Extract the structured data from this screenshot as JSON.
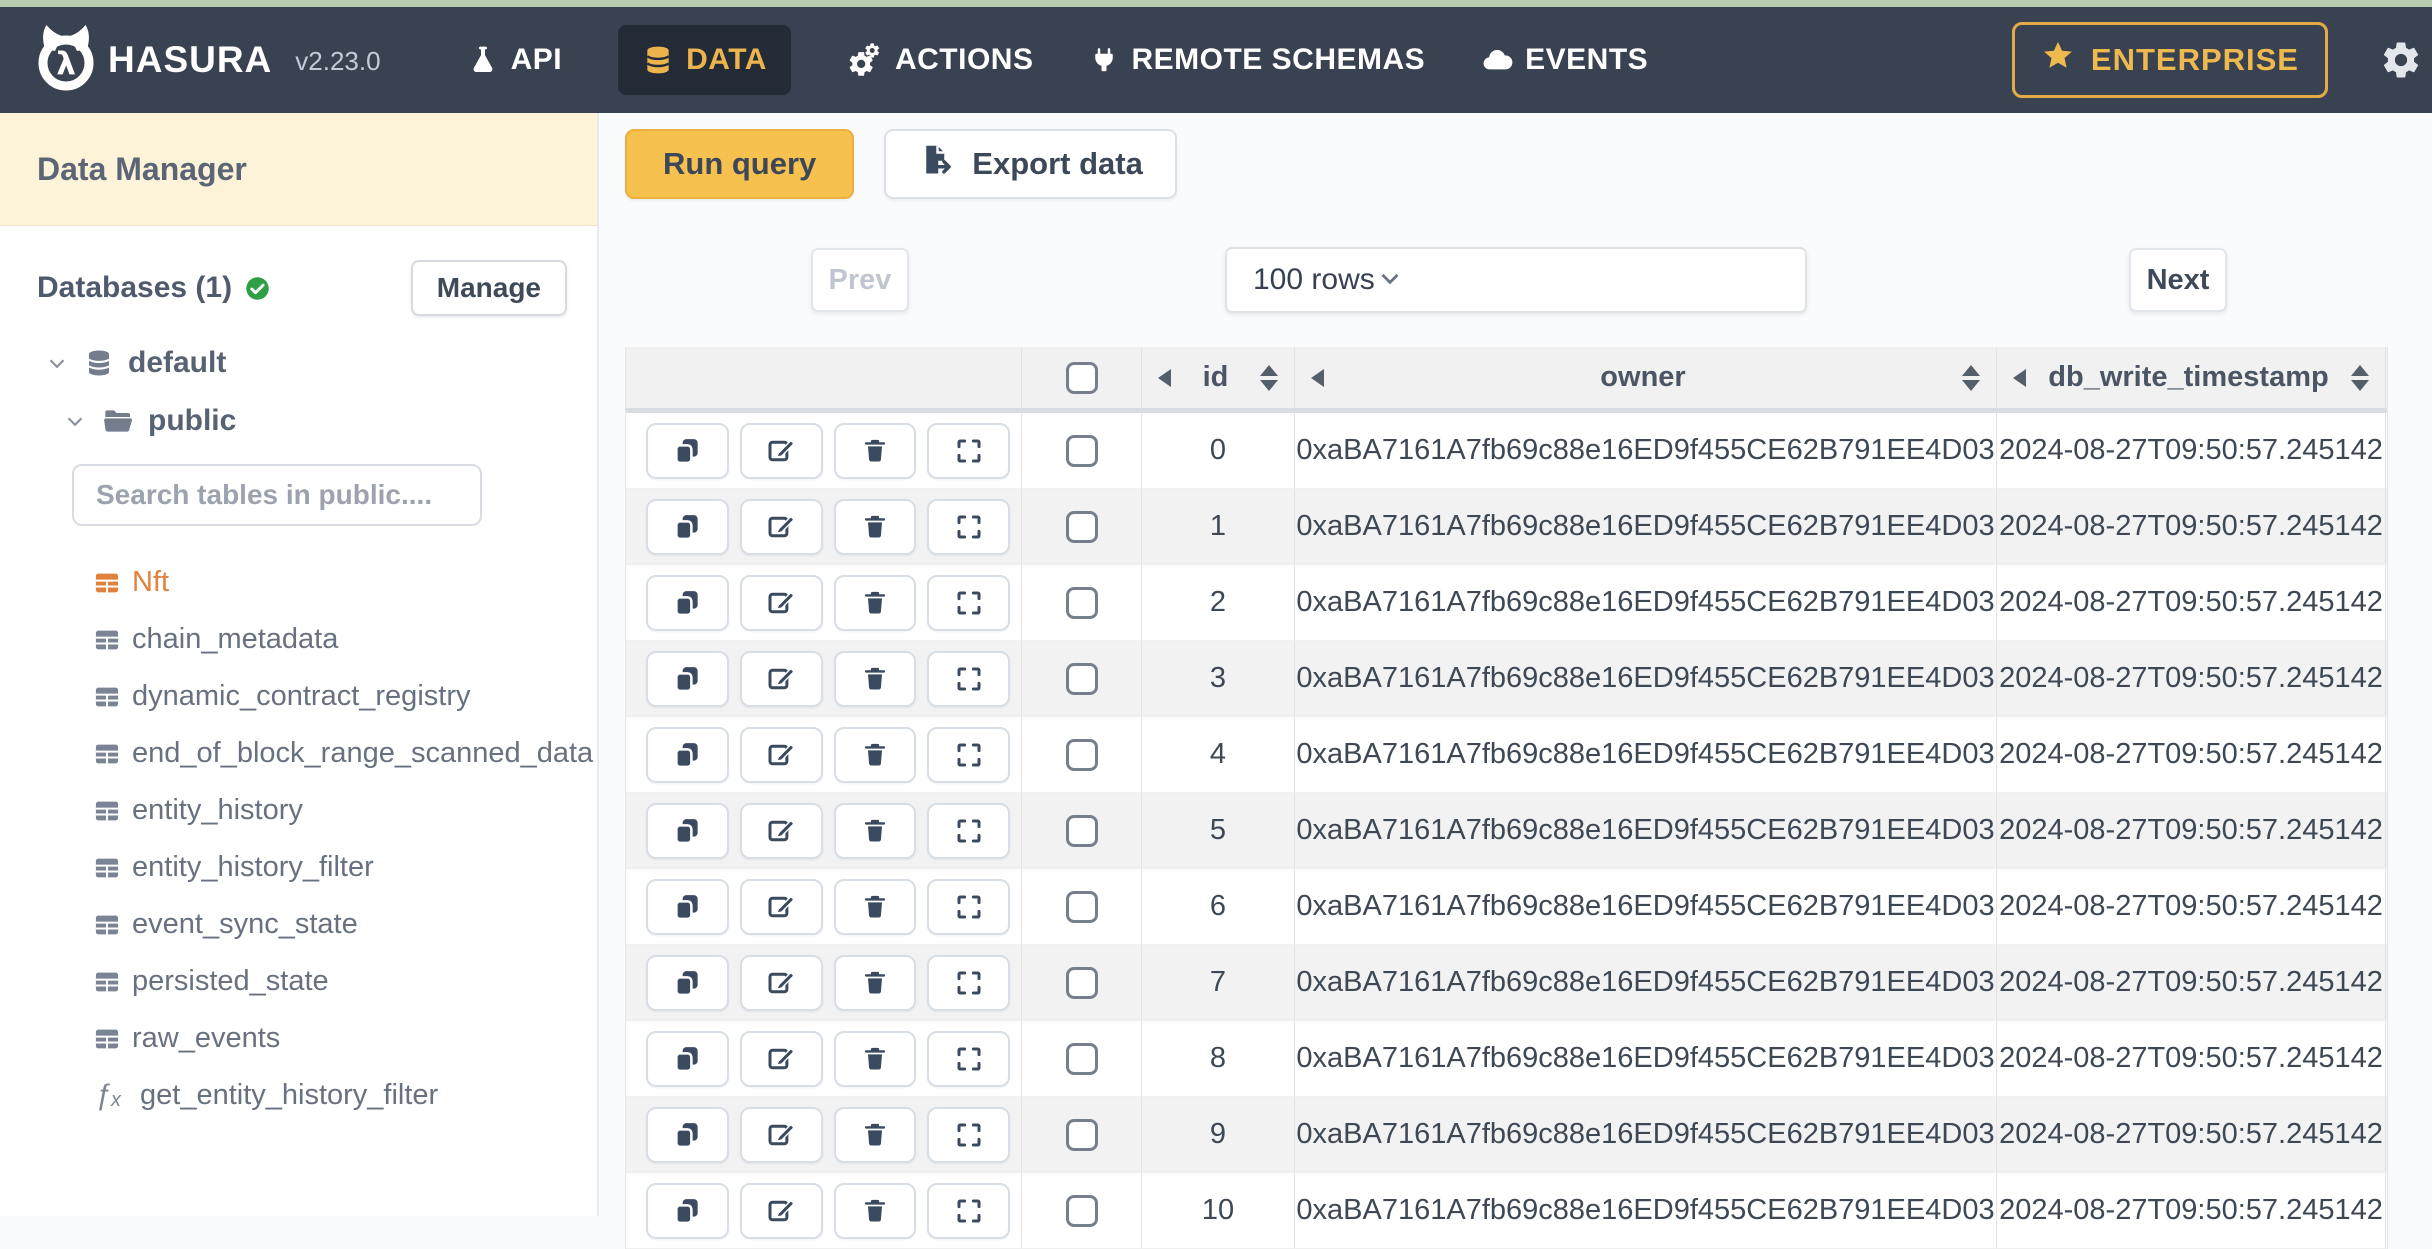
{
  "nav": {
    "brand": "HASURA",
    "version": "v2.23.0",
    "items": [
      {
        "label": "API",
        "icon": "flask-icon",
        "active": false
      },
      {
        "label": "DATA",
        "icon": "database-icon",
        "active": true
      },
      {
        "label": "ACTIONS",
        "icon": "gears-icon",
        "active": false
      },
      {
        "label": "REMOTE SCHEMAS",
        "icon": "plug-icon",
        "active": false
      },
      {
        "label": "EVENTS",
        "icon": "cloud-icon",
        "active": false
      }
    ],
    "enterprise": "ENTERPRISE"
  },
  "sidebar": {
    "title": "Data Manager",
    "databases_label": "Databases (1)",
    "manage_button": "Manage",
    "database_name": "default",
    "schema_name": "public",
    "search_placeholder": "Search tables in public....",
    "tables": [
      {
        "name": "Nft",
        "active": true
      },
      {
        "name": "chain_metadata",
        "active": false
      },
      {
        "name": "dynamic_contract_registry",
        "active": false
      },
      {
        "name": "end_of_block_range_scanned_data",
        "active": false
      },
      {
        "name": "entity_history",
        "active": false
      },
      {
        "name": "entity_history_filter",
        "active": false
      },
      {
        "name": "event_sync_state",
        "active": false
      },
      {
        "name": "persisted_state",
        "active": false
      },
      {
        "name": "raw_events",
        "active": false
      }
    ],
    "functions": [
      {
        "name": "get_entity_history_filter"
      }
    ]
  },
  "toolbar": {
    "run_query": "Run query",
    "export_data": "Export data"
  },
  "pagination": {
    "prev": "Prev",
    "page_size": "100 rows",
    "next": "Next"
  },
  "table": {
    "columns": [
      {
        "key": "id",
        "label": "id"
      },
      {
        "key": "owner",
        "label": "owner"
      },
      {
        "key": "ts",
        "label": "db_write_timestamp"
      }
    ],
    "row_actions": [
      "clone",
      "edit",
      "delete",
      "expand"
    ],
    "rows": [
      {
        "id": "0",
        "owner": "0xaBA7161A7fb69c88e16ED9f455CE62B791EE4D03",
        "ts": "2024-08-27T09:50:57.245142"
      },
      {
        "id": "1",
        "owner": "0xaBA7161A7fb69c88e16ED9f455CE62B791EE4D03",
        "ts": "2024-08-27T09:50:57.245142"
      },
      {
        "id": "2",
        "owner": "0xaBA7161A7fb69c88e16ED9f455CE62B791EE4D03",
        "ts": "2024-08-27T09:50:57.245142"
      },
      {
        "id": "3",
        "owner": "0xaBA7161A7fb69c88e16ED9f455CE62B791EE4D03",
        "ts": "2024-08-27T09:50:57.245142"
      },
      {
        "id": "4",
        "owner": "0xaBA7161A7fb69c88e16ED9f455CE62B791EE4D03",
        "ts": "2024-08-27T09:50:57.245142"
      },
      {
        "id": "5",
        "owner": "0xaBA7161A7fb69c88e16ED9f455CE62B791EE4D03",
        "ts": "2024-08-27T09:50:57.245142"
      },
      {
        "id": "6",
        "owner": "0xaBA7161A7fb69c88e16ED9f455CE62B791EE4D03",
        "ts": "2024-08-27T09:50:57.245142"
      },
      {
        "id": "7",
        "owner": "0xaBA7161A7fb69c88e16ED9f455CE62B791EE4D03",
        "ts": "2024-08-27T09:50:57.245142"
      },
      {
        "id": "8",
        "owner": "0xaBA7161A7fb69c88e16ED9f455CE62B791EE4D03",
        "ts": "2024-08-27T09:50:57.245142"
      },
      {
        "id": "9",
        "owner": "0xaBA7161A7fb69c88e16ED9f455CE62B791EE4D03",
        "ts": "2024-08-27T09:50:57.245142"
      },
      {
        "id": "10",
        "owner": "0xaBA7161A7fb69c88e16ED9f455CE62B791EE4D03",
        "ts": "2024-08-27T09:50:57.245142"
      }
    ]
  },
  "colors": {
    "nav_bg": "#394250",
    "accent_yellow": "#edb44d",
    "run_button_yellow": "#f6c14f",
    "active_table_orange": "#e0813c",
    "success_green": "#2f9e44",
    "sidebar_header_cream": "#fcf3d9",
    "row_stripe_gray": "#f2f2f2"
  }
}
